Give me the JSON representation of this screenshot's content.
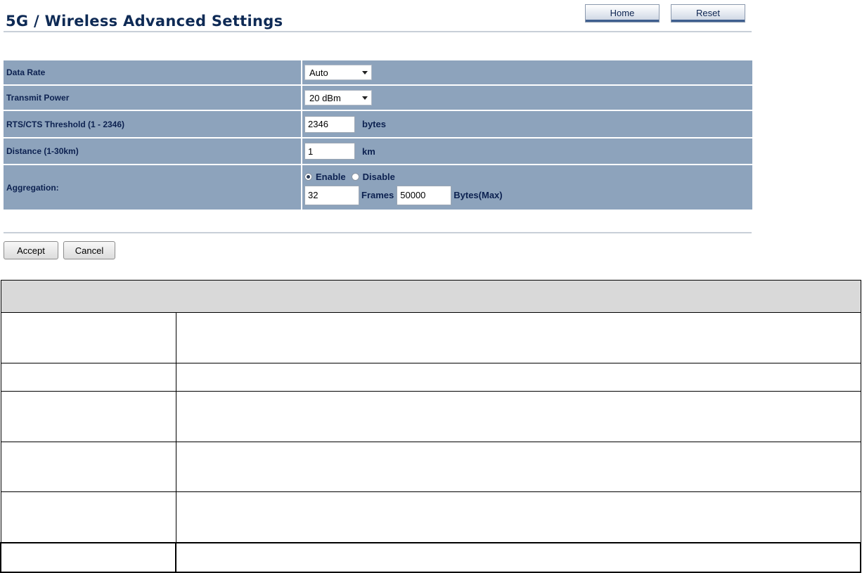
{
  "page": {
    "title": "5G / Wireless Advanced Settings"
  },
  "header_buttons": {
    "home": "Home",
    "reset": "Reset"
  },
  "settings": {
    "data_rate": {
      "label": "Data Rate",
      "value": "Auto"
    },
    "transmit_power": {
      "label": "Transmit Power",
      "value": "20 dBm"
    },
    "rts_cts": {
      "label": "RTS/CTS Threshold (1 - 2346)",
      "value": "2346",
      "unit": "bytes"
    },
    "distance": {
      "label": "Distance (1-30km)",
      "value": "1",
      "unit": "km"
    },
    "aggregation": {
      "label": "Aggregation:",
      "enable_label": "Enable",
      "disable_label": "Disable",
      "selected": "Enable",
      "frames_value": "32",
      "frames_label": "Frames",
      "bytes_value": "50000",
      "bytes_label": "Bytes(Max)"
    }
  },
  "actions": {
    "accept": "Accept",
    "cancel": "Cancel"
  },
  "description_table": {
    "rows": [
      {
        "name": "",
        "text": ""
      },
      {
        "name": "",
        "text": ""
      },
      {
        "name": "",
        "text": ""
      },
      {
        "name": "",
        "text": ""
      },
      {
        "name": "",
        "text": ""
      },
      {
        "name": "",
        "text": ""
      }
    ]
  }
}
